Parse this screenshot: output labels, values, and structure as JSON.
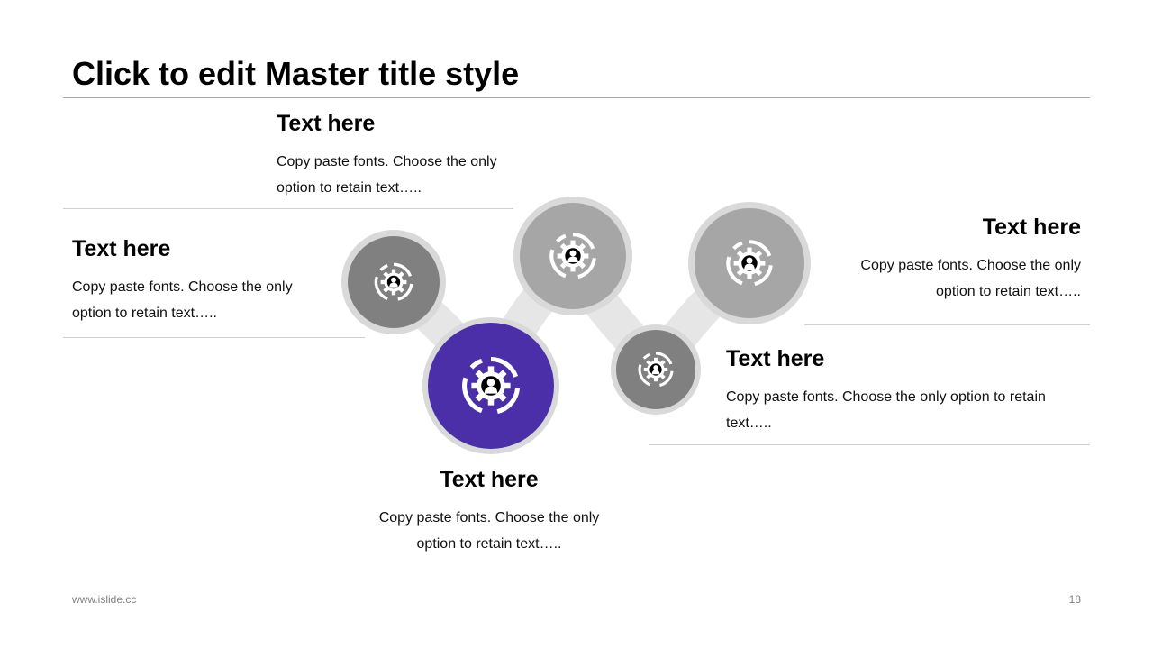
{
  "slide": {
    "title": "Click to edit Master title style",
    "footer_url": "www.islide.cc",
    "page_number": "18"
  },
  "items": [
    {
      "heading": "Text here",
      "body": "Copy paste fonts. Choose the only option to retain text….."
    },
    {
      "heading": "Text here",
      "body": "Copy paste fonts. Choose the only option to retain text….."
    },
    {
      "heading": "Text here",
      "body": "Copy paste fonts. Choose the only option to retain text….."
    },
    {
      "heading": "Text here",
      "body": "Copy paste fonts. Choose the only option to retain text….."
    },
    {
      "heading": "Text here",
      "body": "Copy paste fonts. Choose the only option to retain text….."
    }
  ],
  "icons": [
    "gear-user-icon",
    "gear-user-icon",
    "gear-user-icon",
    "gear-user-icon",
    "gear-user-icon"
  ],
  "colors": {
    "accent": "#4a2fa8",
    "dark_gray": "#808080",
    "light_gray": "#a6a6a6",
    "ring": "#d9d9d9",
    "connector": "#e6e6e6"
  }
}
